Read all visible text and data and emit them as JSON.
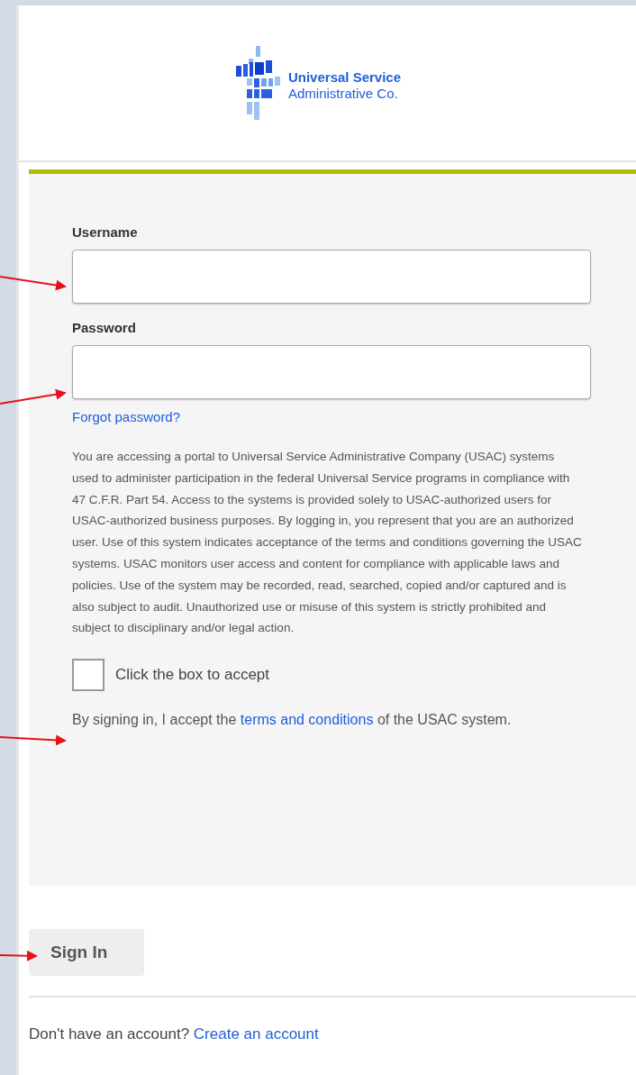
{
  "logo": {
    "line_1": "Universal Service",
    "line_2": "Administrative Co."
  },
  "form": {
    "username": {
      "label": "Username"
    },
    "password": {
      "label": "Password"
    },
    "forgot_link": "Forgot password?",
    "disclaimer": "You are accessing a portal to Universal Service Administrative Company (USAC) systems used to administer participation in the federal Universal Service programs in compliance with 47 C.F.R. Part 54. Access to the systems is provided solely to USAC-authorized users for USAC-authorized business purposes. By logging in, you represent that you are an authorized user. Use of this system indicates acceptance of the terms and conditions governing the USAC systems. USAC monitors user access and content for compliance with applicable laws and policies. Use of the system may be recorded, read, searched, copied and/or captured and is also subject to audit. Unauthorized use or misuse of this system is strictly prohibited and subject to disciplinary and/or legal action.",
    "accept": {
      "label": "Click the box to accept",
      "checked": false
    },
    "terms": {
      "before": "By signing in, I accept the",
      "link": "terms and conditions",
      "after": "of the USAC system."
    }
  },
  "sign_in_button": "Sign In",
  "footer": {
    "text": "Don't have an account?",
    "link": "Create an account"
  }
}
